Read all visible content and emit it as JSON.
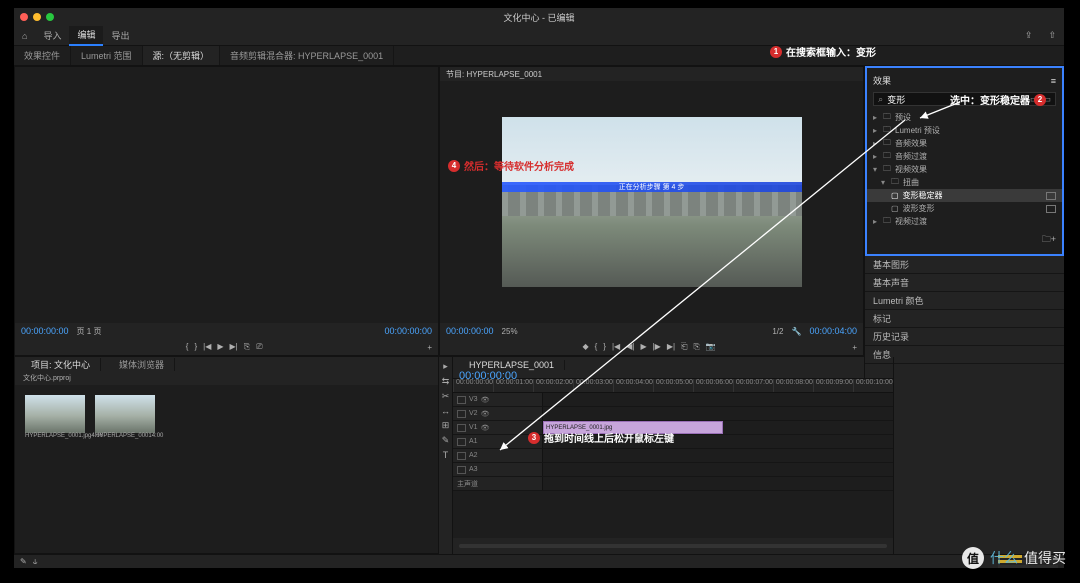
{
  "window_title": "文化中心 - 已编辑",
  "topmenu": {
    "home_icon": "⌂",
    "import": "导入",
    "edit": "编辑",
    "export": "导出"
  },
  "tabs": {
    "t0": "效果控件",
    "t1": "Lumetri 范围",
    "t2": "源:（无剪辑）",
    "t3": "音频剪辑混合器: HYPERLAPSE_0001"
  },
  "source": {
    "tc_left": "00:00:00:00",
    "pages": "页 1 页",
    "tc_right": "00:00:00:00"
  },
  "program": {
    "header": "节目: HYPERLAPSE_0001",
    "analysis_label": "正在分析步骤 第 4 步",
    "tc_left": "00:00:00:00",
    "zoom": "25%",
    "fit": "1/2",
    "tc_right": "00:00:04:00"
  },
  "effects": {
    "title": "效果",
    "search_value": "变形",
    "clear_icon": "×",
    "tree": {
      "presets": "预设",
      "lumetri": "Lumetri 预设",
      "audio_fx": "音频效果",
      "audio_tr": "音频过渡",
      "video_fx": "视频效果",
      "distort": "扭曲",
      "warp_stab": "变形稳定器",
      "lens_dist": "波形变形",
      "video_tr": "视频过渡"
    }
  },
  "side_panels": {
    "p0": "基本图形",
    "p1": "基本声音",
    "p2": "Lumetri 颜色",
    "p3": "标记",
    "p4": "历史记录",
    "p5": "信息"
  },
  "project": {
    "tab0": "项目: 文化中心",
    "tab1": "媒体浏览器",
    "file": "文化中心.prproj",
    "items": [
      {
        "name": "HYPERLAPSE_0001.jpg",
        "dur": "4:00"
      },
      {
        "name": "HYPERLAPSE_0001",
        "dur": "4:00"
      }
    ]
  },
  "timeline": {
    "seq_tab": "HYPERLAPSE_0001",
    "playhead": "00:00:00:00",
    "ticks": [
      "00:00:00:00",
      "00:00:01:00",
      "00:00:02:00",
      "00:00:03:00",
      "00:00:04:00",
      "00:00:05:00",
      "00:00:06:00",
      "00:00:07:00",
      "00:00:08:00",
      "00:00:09:00",
      "00:00:10:00"
    ],
    "tracks": {
      "v3": "V3",
      "v2": "V2",
      "v1": "V1",
      "a1": "A1",
      "a2": "A2",
      "a3": "A3",
      "master": "主声道"
    },
    "clip_name": "HYPERLAPSE_0001.jpg",
    "toggle_icon": "👁"
  },
  "tools": [
    "▸",
    "⇆",
    "✂",
    "↔",
    "⊞",
    "✎",
    "T"
  ],
  "annotations": {
    "a1_num": "1",
    "a1_text": "在搜索框输入：变形",
    "a2_num": "2",
    "a2_text": "选中：变形稳定器",
    "a3_num": "3",
    "a3_text": "拖到时间线上后松开鼠标左键",
    "a4_num": "4",
    "a4_text": "然后：等待软件分析完成"
  },
  "watermark": {
    "char": "值",
    "t1": "什么",
    "t2": "值得买"
  }
}
